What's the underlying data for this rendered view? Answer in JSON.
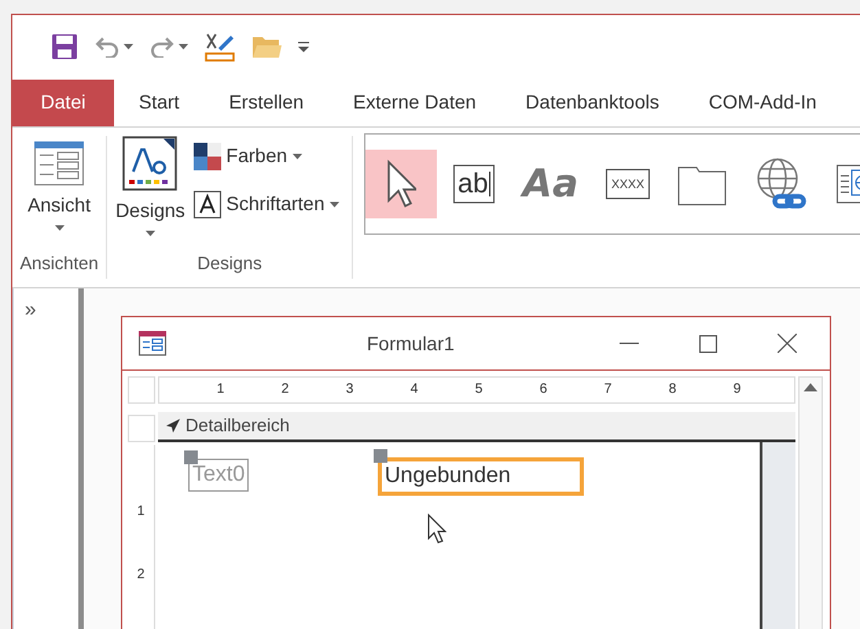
{
  "ribbon_tabs": [
    {
      "label": "Datei",
      "kind": "file"
    },
    {
      "label": "Start",
      "kind": "tab"
    },
    {
      "label": "Erstellen",
      "kind": "tab"
    },
    {
      "label": "Externe Daten",
      "kind": "tab"
    },
    {
      "label": "Datenbanktools",
      "kind": "tab"
    },
    {
      "label": "COM-Add-In",
      "kind": "tab"
    }
  ],
  "groups": {
    "views": {
      "button": "Ansicht",
      "label": "Ansichten"
    },
    "designs": {
      "button": "Designs",
      "colors": "Farben",
      "fonts": "Schriftarten",
      "label": "Designs"
    }
  },
  "controls": [
    {
      "kind": "pointer",
      "selected": true
    },
    {
      "kind": "textbox",
      "label": "ab",
      "selected": false
    },
    {
      "kind": "label",
      "label": "Aa",
      "selected": false
    },
    {
      "kind": "button",
      "label": "XXXX",
      "selected": false
    },
    {
      "kind": "tab",
      "selected": false
    },
    {
      "kind": "hyperlink",
      "selected": false
    },
    {
      "kind": "browser",
      "selected": false
    }
  ],
  "nav_pane": {
    "toggle": "»"
  },
  "form_window": {
    "title": "Formular1",
    "ruler": [
      "1",
      "2",
      "3",
      "4",
      "5",
      "6",
      "7",
      "8",
      "9"
    ],
    "vertical_ruler": [
      "1",
      "2"
    ],
    "section": "Detailbereich",
    "fields": [
      {
        "kind": "label",
        "text": "Text0",
        "selected": false
      },
      {
        "kind": "textbox",
        "text": "Ungebunden",
        "selected": true
      }
    ]
  }
}
